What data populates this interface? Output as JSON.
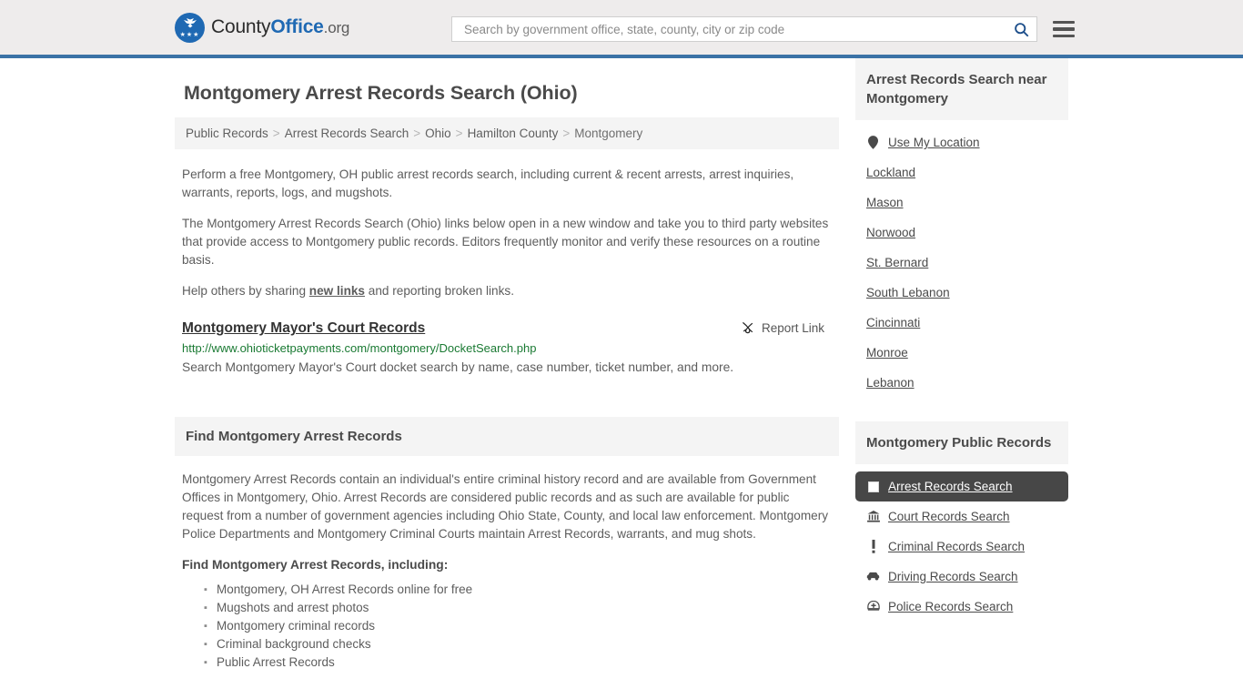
{
  "header": {
    "logo": {
      "part1": "County",
      "part2": "Office",
      "suffix": ".org",
      "icon": "eagle-seal-icon"
    },
    "search": {
      "placeholder": "Search by government office, state, county, city or zip code",
      "value": "",
      "icon": "search-icon",
      "button_label": "Search"
    },
    "menu": {
      "icon": "hamburger-menu-icon",
      "label": "Menu"
    },
    "accent_color": "#3b72a6"
  },
  "page": {
    "title": "Montgomery Arrest Records Search (Ohio)"
  },
  "breadcrumb": {
    "items": [
      {
        "label": "Public Records",
        "current": false
      },
      {
        "label": "Arrest Records Search",
        "current": false
      },
      {
        "label": "Ohio",
        "current": false
      },
      {
        "label": "Hamilton County",
        "current": false
      },
      {
        "label": "Montgomery",
        "current": true
      }
    ],
    "separator": ">"
  },
  "intro": {
    "paragraph1": "Perform a free Montgomery, OH public arrest records search, including current & recent arrests, arrest inquiries, warrants, reports, logs, and mugshots.",
    "paragraph2": "The Montgomery Arrest Records Search (Ohio) links below open in a new window and take you to third party websites that provide access to Montgomery public records. Editors frequently monitor and verify these resources on a routine basis.",
    "paragraph3_prefix": "Help others by sharing ",
    "paragraph3_link": "new links",
    "paragraph3_suffix": " and reporting broken links."
  },
  "result": {
    "title": "Montgomery Mayor's Court Records",
    "url": "http://www.ohioticketpayments.com/montgomery/DocketSearch.php",
    "description": "Search Montgomery Mayor's Court docket search by name, case number, ticket number, and more.",
    "report_label": "Report Link",
    "report_icon": "broken-link-icon"
  },
  "find_section": {
    "heading": "Find Montgomery Arrest Records",
    "body": "Montgomery Arrest Records contain an individual's entire criminal history record and are available from Government Offices in Montgomery, Ohio. Arrest Records are considered public records and as such are available for public request from a number of government agencies including Ohio State, County, and local law enforcement. Montgomery Police Departments and Montgomery Criminal Courts maintain Arrest Records, warrants, and mug shots.",
    "list_heading": "Find Montgomery Arrest Records, including:",
    "items": [
      "Montgomery, OH Arrest Records online for free",
      "Mugshots and arrest photos",
      "Montgomery criminal records",
      "Criminal background checks",
      "Public Arrest Records"
    ]
  },
  "sidebar": {
    "nearby": {
      "heading": "Arrest Records Search near Montgomery",
      "use_my_location": {
        "label": "Use My Location",
        "icon": "map-pin-icon"
      },
      "places": [
        "Lockland",
        "Mason",
        "Norwood",
        "St. Bernard",
        "South Lebanon",
        "Cincinnati",
        "Monroe",
        "Lebanon"
      ]
    },
    "public_records": {
      "heading": "Montgomery Public Records",
      "items": [
        {
          "label": "Arrest Records Search",
          "icon": "id-card-icon",
          "active": true
        },
        {
          "label": "Court Records Search",
          "icon": "courthouse-icon",
          "active": false
        },
        {
          "label": "Criminal Records Search",
          "icon": "exclamation-icon",
          "active": false
        },
        {
          "label": "Driving Records Search",
          "icon": "car-icon",
          "active": false
        },
        {
          "label": "Police Records Search",
          "icon": "police-badge-icon",
          "active": false
        }
      ],
      "active_background": "#474747"
    }
  }
}
